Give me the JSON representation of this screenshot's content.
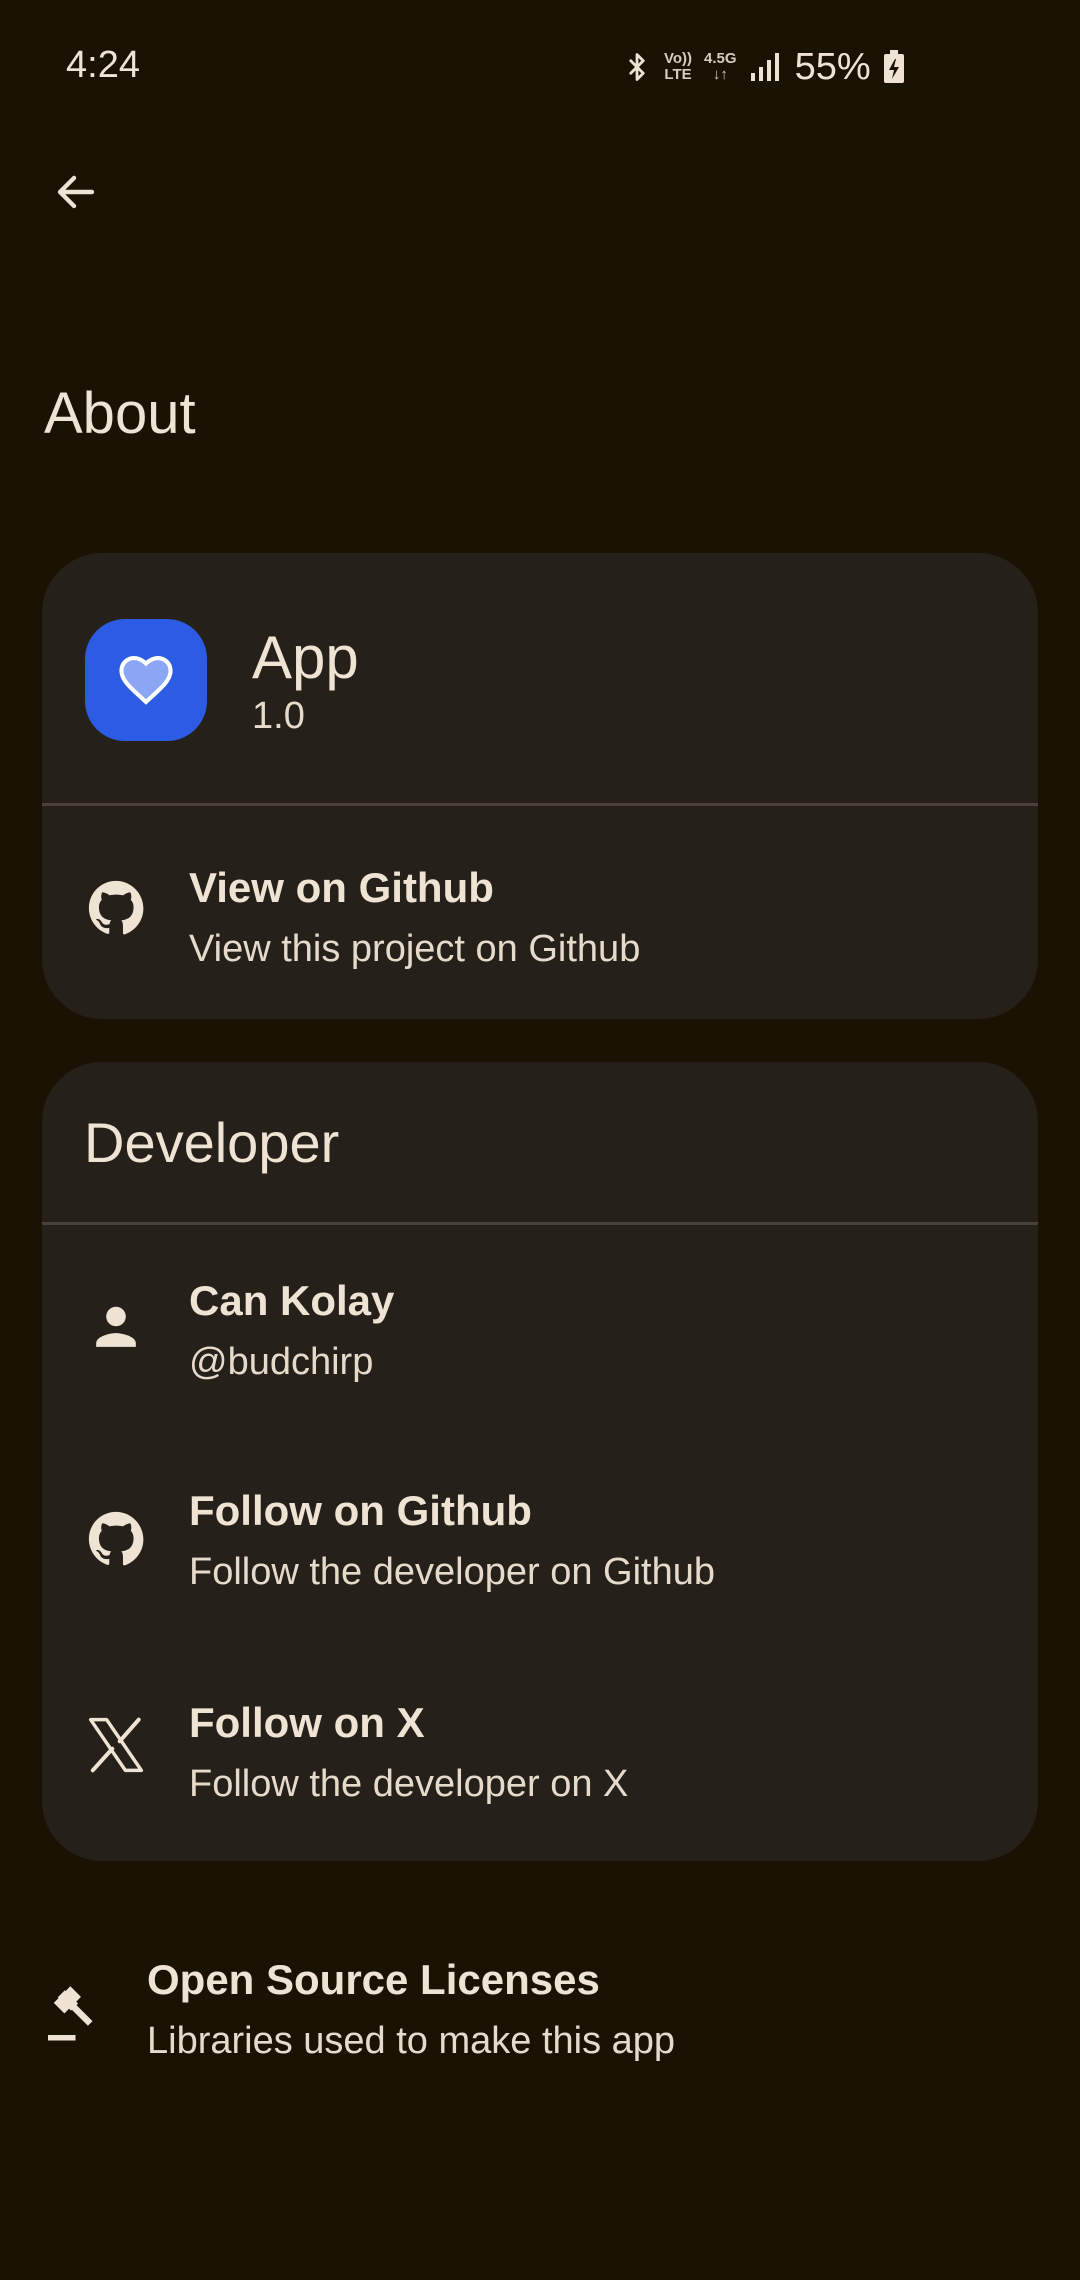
{
  "status_bar": {
    "time": "4:24",
    "volte_top": "Vo))",
    "volte_bottom": "LTE",
    "network_top": "4.5G",
    "network_bottom": "↓↑",
    "battery": "55%",
    "icons": [
      "bluetooth-icon",
      "volte-icon",
      "network-4-5g-icon",
      "signal-icon",
      "battery-charging-icon"
    ]
  },
  "top_bar": {
    "back_icon": "arrow-back-icon"
  },
  "page": {
    "title": "About"
  },
  "app_card": {
    "app_name": "App",
    "version": "1.0",
    "icon": "heart-icon",
    "icon_bg_color": "#2c5ce3",
    "github": {
      "title": "View on Github",
      "subtitle": "View this project on Github",
      "icon": "github-icon"
    }
  },
  "developer_card": {
    "title": "Developer",
    "items": [
      {
        "title": "Can Kolay",
        "subtitle": "@budchirp",
        "icon": "person-icon"
      },
      {
        "title": "Follow on Github",
        "subtitle": "Follow the developer on Github",
        "icon": "github-icon"
      },
      {
        "title": "Follow on X",
        "subtitle": "Follow the developer on X",
        "icon": "x-logo-icon"
      }
    ]
  },
  "licenses": {
    "title": "Open Source Licenses",
    "subtitle": "Libraries used to make this app",
    "icon": "gavel-icon"
  },
  "colors": {
    "background": "#1a1303",
    "card": "#26201a",
    "text": "#efe3d3",
    "accent": "#2c5ce3"
  }
}
